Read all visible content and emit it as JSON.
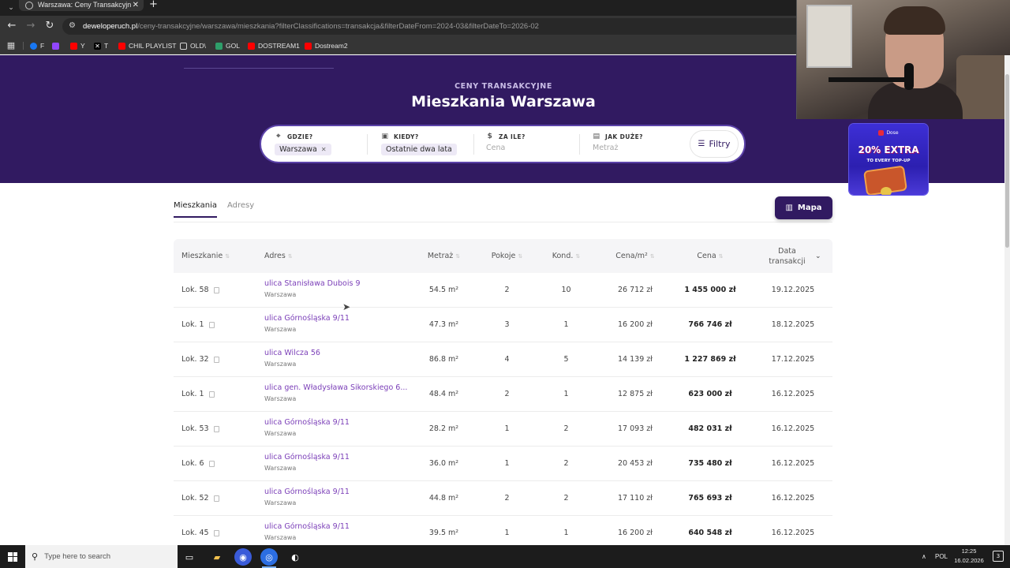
{
  "browser": {
    "tab_title": "Warszawa: Ceny Transakcyjne M",
    "tab_close": "✕",
    "new_tab": "+",
    "url_host": "deweloperuch.pl",
    "url_path": "/ceny-transakcyjne/warszawa/mieszkania?filterClassifications=transakcja&filterDateFrom=2024-03&filterDateTo=2026-02",
    "bookmarks": [
      {
        "label": "F",
        "color": "#1877f2"
      },
      {
        "label": "",
        "color": "#9146ff"
      },
      {
        "label": "Y",
        "color": "#ff0000"
      },
      {
        "label": "T",
        "color": "#000000"
      },
      {
        "label": "CHIL PLAYLIST",
        "color": "#ff0000"
      },
      {
        "label": "OLD\\",
        "color": "#353535"
      },
      {
        "label": "GOL",
        "color": "#2e9e6a"
      },
      {
        "label": "DOSTREAM1",
        "color": "#ff0000"
      },
      {
        "label": "Dostream2",
        "color": "#ff0000"
      }
    ]
  },
  "hero": {
    "kicker": "CENY TRANSAKCYJNE",
    "title": "Mieszkania Warszawa"
  },
  "search": {
    "where_label": "GDZIE?",
    "where_value": "Warszawa",
    "when_label": "KIEDY?",
    "when_value": "Ostatnie dwa lata",
    "price_label": "ZA ILE?",
    "price_placeholder": "Cena",
    "size_label": "JAK DUŻE?",
    "size_placeholder": "Metraż",
    "filters_label": "Filtry"
  },
  "tabs": [
    {
      "label": "Mieszkania",
      "active": true
    },
    {
      "label": "Adresy",
      "active": false
    }
  ],
  "map_button": "Mapa",
  "table": {
    "columns": [
      "Mieszkanie",
      "Adres",
      "Metraż",
      "Pokoje",
      "Kond.",
      "Cena/m²",
      "Cena",
      "Data transakcji"
    ],
    "rows": [
      {
        "unit": "Lok. 58",
        "address": "ulica Stanisława Dubois 9",
        "city": "Warszawa",
        "area": "54.5 m²",
        "rooms": "2",
        "floor": "10",
        "ppm": "26 712 zł",
        "price": "1 455 000 zł",
        "date": "19.12.2025"
      },
      {
        "unit": "Lok. 1",
        "address": "ulica Górnośląska 9/11",
        "city": "Warszawa",
        "area": "47.3 m²",
        "rooms": "3",
        "floor": "1",
        "ppm": "16 200 zł",
        "price": "766 746 zł",
        "date": "18.12.2025"
      },
      {
        "unit": "Lok. 32",
        "address": "ulica Wilcza 56",
        "city": "Warszawa",
        "area": "86.8 m²",
        "rooms": "4",
        "floor": "5",
        "ppm": "14 139 zł",
        "price": "1 227 869 zł",
        "date": "17.12.2025"
      },
      {
        "unit": "Lok. 1",
        "address": "ulica gen. Władysława Sikorskiego 6...",
        "city": "Warszawa",
        "area": "48.4 m²",
        "rooms": "2",
        "floor": "1",
        "ppm": "12 875 zł",
        "price": "623 000 zł",
        "date": "16.12.2025"
      },
      {
        "unit": "Lok. 53",
        "address": "ulica Górnośląska 9/11",
        "city": "Warszawa",
        "area": "28.2 m²",
        "rooms": "1",
        "floor": "2",
        "ppm": "17 093 zł",
        "price": "482 031 zł",
        "date": "16.12.2025"
      },
      {
        "unit": "Lok. 6",
        "address": "ulica Górnośląska 9/11",
        "city": "Warszawa",
        "area": "36.0 m²",
        "rooms": "1",
        "floor": "2",
        "ppm": "20 453 zł",
        "price": "735 480 zł",
        "date": "16.12.2025"
      },
      {
        "unit": "Lok. 52",
        "address": "ulica Górnośląska 9/11",
        "city": "Warszawa",
        "area": "44.8 m²",
        "rooms": "2",
        "floor": "2",
        "ppm": "17 110 zł",
        "price": "765 693 zł",
        "date": "16.12.2025"
      },
      {
        "unit": "Lok. 45",
        "address": "ulica Górnośląska 9/11",
        "city": "Warszawa",
        "area": "39.5 m²",
        "rooms": "1",
        "floor": "1",
        "ppm": "16 200 zł",
        "price": "640 548 zł",
        "date": "16.12.2025"
      }
    ]
  },
  "ad": {
    "brand": "Dose",
    "headline": "20% EXTRA",
    "subline": "TO EVERY TOP-UP"
  },
  "taskbar": {
    "search_placeholder": "Type here to search",
    "language": "POL",
    "time": "12:25",
    "date": "16.02.2026",
    "notification_count": "3"
  }
}
